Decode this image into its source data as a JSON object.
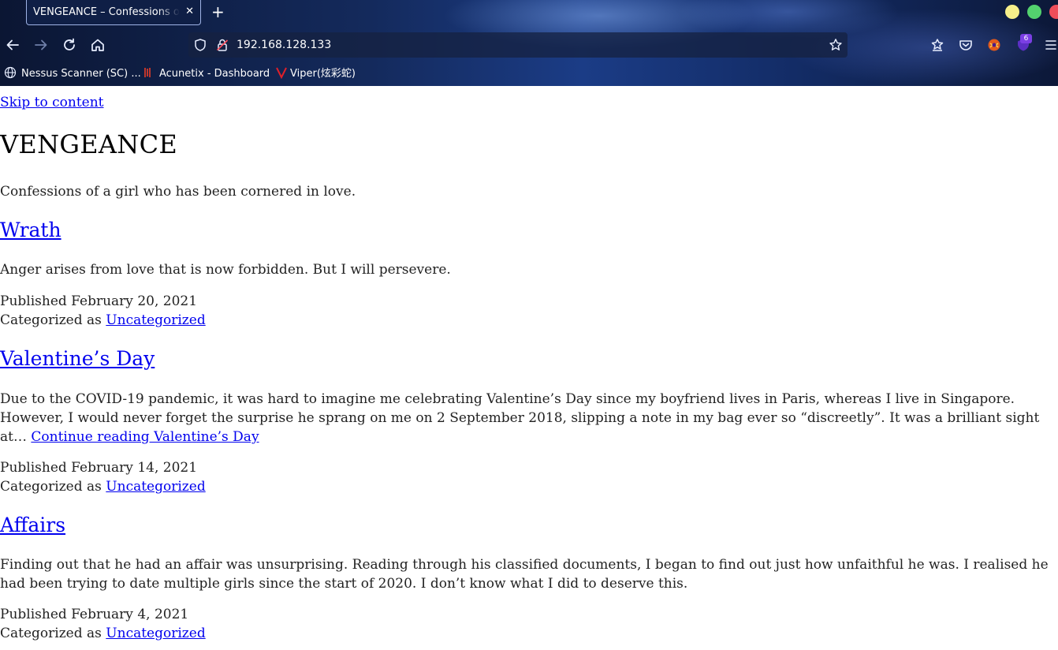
{
  "browser": {
    "tab_title": "VENGEANCE – Confessions of a girl who has been cornered in love",
    "tab_close": "✕",
    "new_tab": "+",
    "url": "192.168.128.133",
    "extension_badge": "6",
    "bookmarks": [
      {
        "label": "Nessus Scanner (SC) ...",
        "icon": "globe-icon"
      },
      {
        "label": "Acunetix - Dashboard",
        "icon": "acunetix-icon"
      },
      {
        "label": "Viper(炫彩蛇)",
        "icon": "viper-icon"
      }
    ],
    "colors": {
      "min": "#f6ef8a",
      "max": "#53d26e",
      "close": "#ef4e5a"
    }
  },
  "page": {
    "skip_link": "Skip to content",
    "site_title": "VENGEANCE",
    "tagline": "Confessions of a girl who has been cornered in love.",
    "posts": [
      {
        "title": "Wrath",
        "excerpt": "Anger arises from love that is now forbidden. But I will persevere.",
        "published": "Published February 20, 2021",
        "category_prefix": "Categorized as ",
        "category": "Uncategorized"
      },
      {
        "title": "Valentine’s Day",
        "excerpt": "Due to the COVID-19 pandemic, it was hard to imagine me celebrating Valentine’s Day since my boyfriend lives in Paris, whereas I live in Singapore. However, I would never forget the surprise he sprang on me on 2 September 2018, slipping a note in my bag ever so “discreetly”. It was a brilliant sight at… ",
        "continue_link": "Continue reading Valentine’s Day",
        "published": "Published February 14, 2021",
        "category_prefix": "Categorized as ",
        "category": "Uncategorized"
      },
      {
        "title": "Affairs",
        "excerpt": "Finding out that he had an affair was unsurprising. Reading through his classified documents, I began to find out just how unfaithful he was. I realised he had been trying to date multiple girls since the start of 2020. I don’t know what I did to deserve this.",
        "published": "Published February 4, 2021",
        "category_prefix": "Categorized as ",
        "category": "Uncategorized"
      }
    ]
  }
}
